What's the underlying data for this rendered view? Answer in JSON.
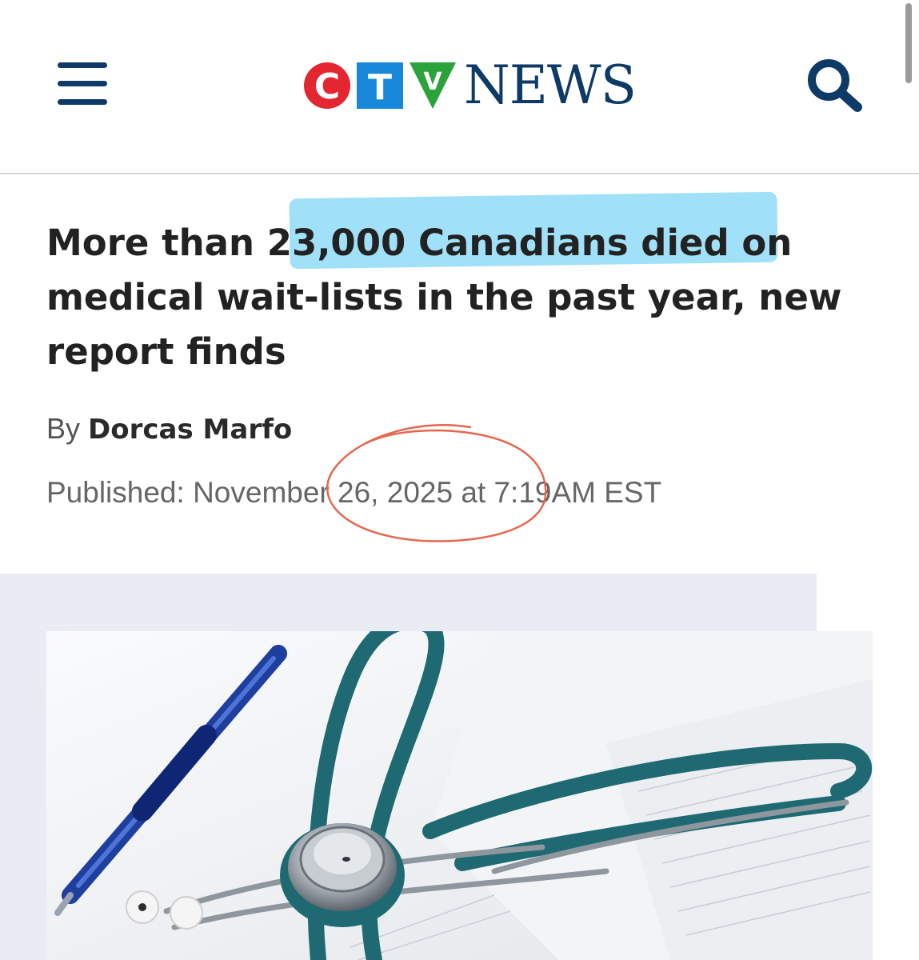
{
  "header": {
    "logo_letters": [
      "C",
      "T",
      "V"
    ],
    "logo_word": "NEWS",
    "colors": {
      "navy": "#0d3a66",
      "red": "#e3262f",
      "blue": "#1687d9",
      "green": "#2aa33b"
    }
  },
  "article": {
    "headline": "More than 23,000 Canadians died on medical wait-lists in the past year, new report finds",
    "byline_prefix": "By",
    "author": "Dorcas Marfo",
    "published": "Published: November 26, 2025 at 7:19AM EST"
  },
  "image": {
    "description_icons": [
      "stethoscope-icon",
      "pen-icon",
      "papers"
    ]
  }
}
